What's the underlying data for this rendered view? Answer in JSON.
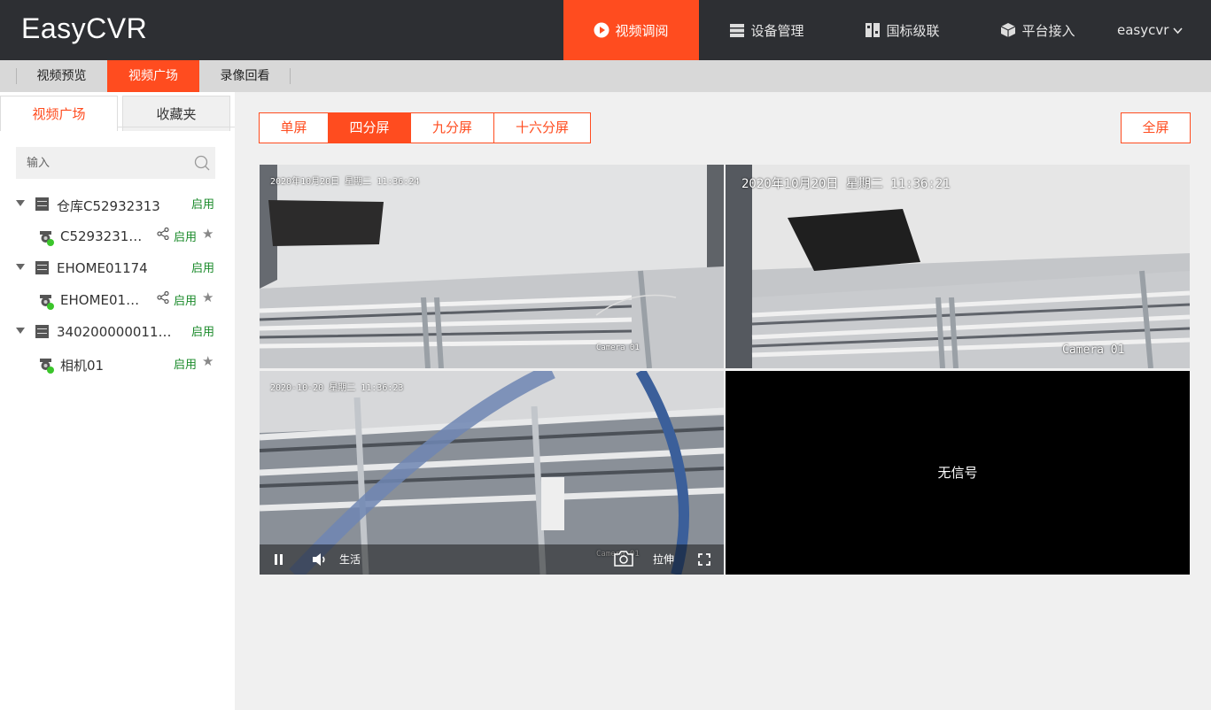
{
  "app": {
    "logo": "EasyCVR"
  },
  "nav": {
    "items": [
      {
        "label": "视频调阅",
        "icon": "play-circle-icon",
        "active": true
      },
      {
        "label": "设备管理",
        "icon": "list-icon",
        "active": false
      },
      {
        "label": "国标级联",
        "icon": "cascade-icon",
        "active": false
      },
      {
        "label": "平台接入",
        "icon": "cube-icon",
        "active": false
      }
    ],
    "user": "easycvr"
  },
  "subnav": {
    "tabs": [
      {
        "label": "视频预览",
        "active": false
      },
      {
        "label": "视频广场",
        "active": true
      },
      {
        "label": "录像回看",
        "active": false
      }
    ]
  },
  "sidebar": {
    "tabs": [
      {
        "label": "视频广场",
        "active": true
      },
      {
        "label": "收藏夹",
        "active": false
      }
    ],
    "search_placeholder": "输入",
    "devices": [
      {
        "name": "仓库C52932313",
        "status": "启用",
        "channels": [
          {
            "name": "C52932313…",
            "status": "启用",
            "shareable": true
          }
        ]
      },
      {
        "name": "EHOME01174",
        "status": "启用",
        "channels": [
          {
            "name": "EHOME011…",
            "status": "启用",
            "shareable": true
          }
        ]
      },
      {
        "name": "34020000001110…",
        "status": "启用",
        "channels": [
          {
            "name": "相机01",
            "status": "启用",
            "shareable": false
          }
        ]
      }
    ]
  },
  "toolbar": {
    "splits": [
      {
        "label": "单屏",
        "active": false
      },
      {
        "label": "四分屏",
        "active": true
      },
      {
        "label": "九分屏",
        "active": false
      },
      {
        "label": "十六分屏",
        "active": false
      }
    ],
    "fullscreen_label": "全屏"
  },
  "players": [
    {
      "timestamp": "2020年10月20日  星期二  11:36:24",
      "camera_label": "Camera 01"
    },
    {
      "timestamp": "2020年10月20日   星期二   11:36:21",
      "camera_label": "Camera 01"
    },
    {
      "timestamp": "2020-10-20 星期二 11:36:23",
      "camera_label": "Camera 01",
      "controls": {
        "mode_label": "生活",
        "stretch_label": "拉伸"
      }
    },
    {
      "no_signal": "无信号"
    }
  ],
  "colors": {
    "accent": "#ff4c1f",
    "topbar": "#2d2f33",
    "status_green": "#1a8a2a"
  }
}
